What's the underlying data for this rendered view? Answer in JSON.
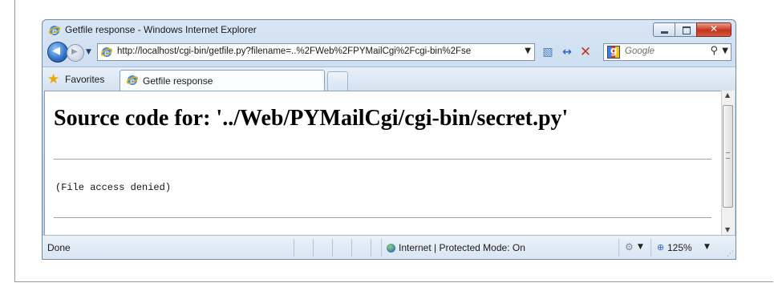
{
  "window": {
    "title": "Getfile response - Windows Internet Explorer"
  },
  "navbar": {
    "address": "http://localhost/cgi-bin/getfile.py?filename=..%2FWeb%2FPYMailCgi%2Fcgi-bin%2Fse",
    "search_placeholder": "Google"
  },
  "favorites": {
    "label": "Favorites"
  },
  "tab": {
    "label": "Getfile response"
  },
  "page": {
    "heading": "Source code for: '../Web/PYMailCgi/cgi-bin/secret.py'",
    "body": "(File access denied)"
  },
  "status": {
    "text": "Done",
    "zone": "Internet | Protected Mode: On",
    "zoom": "125%"
  },
  "colors": {
    "accent": "#2f6fc8",
    "close": "#c4331c"
  }
}
